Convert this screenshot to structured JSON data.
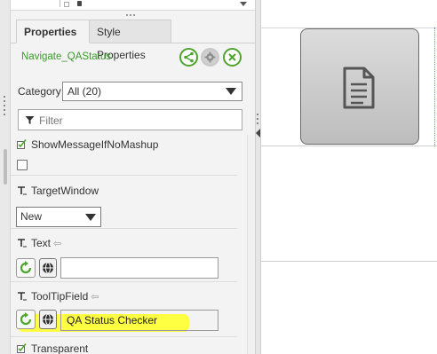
{
  "tabs": {
    "active": "Properties",
    "other": "Style Properties"
  },
  "widget": {
    "name": "Navigate_QAStatus"
  },
  "category": {
    "label": "Category",
    "value": "All (20)"
  },
  "filter": {
    "placeholder": "Filter"
  },
  "properties": {
    "show_message": {
      "label": "ShowMessageIfNoMashup",
      "checked": false
    },
    "target_window": {
      "label": "TargetWindow",
      "value": "New"
    },
    "text": {
      "label": "Text",
      "value": ""
    },
    "tooltip": {
      "label": "ToolTipField",
      "value": "QA Status Checker"
    },
    "transparent": {
      "label": "Transparent"
    }
  },
  "colors": {
    "accent_green": "#4ea42f",
    "highlight": "#ffff33"
  }
}
